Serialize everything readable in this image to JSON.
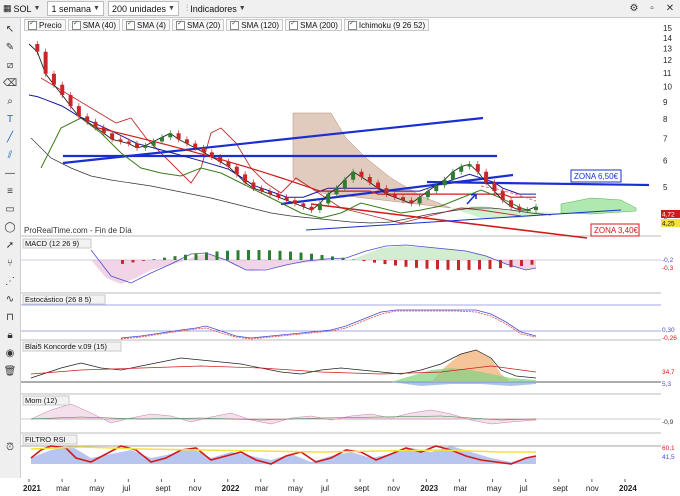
{
  "toolbar": {
    "symbol": "SOL",
    "timeframe": "1 semana",
    "units": "200 unidades",
    "indicators": "Indicadores"
  },
  "legend": {
    "price": "Precio",
    "sma40": "SMA (40)",
    "sma4": "SMA (4)",
    "sma20": "SMA (20)",
    "sma120": "SMA (120)",
    "sma200": "SMA (200)",
    "ichimoku": "Ichimoku (9 26 52)"
  },
  "colors": {
    "sma40": "#1a1a9a",
    "sma4": "#111111",
    "sma20": "#3a7d1e",
    "sma120": "#d11a1a",
    "sma200": "#e06a6a",
    "ichimoku": "#b8312f",
    "up_candle": "#2e7d32",
    "down_candle": "#c62828",
    "cloud_green": "#8ee08e",
    "cloud_red": "#c8a08a",
    "trend_blue": "#1a2fd0",
    "trend_red": "#d11a1a"
  },
  "watermark": "ProRealTime.com - Fin de Día",
  "annotations": {
    "zone_high": "ZONA 6,50€",
    "zone_low": "ZONA 3,40€"
  },
  "panels": {
    "macd": "MACD (12 26 9)",
    "stochastic": "Estocástico (26 8 5)",
    "koncorde": "Blai5 Koncorde v.09 (15)",
    "momentum": "Mom (12)",
    "rsi": "FILTRO RSI"
  },
  "chart_data": {
    "type": "line",
    "price_axis_ticks": [
      "15",
      "14",
      "13",
      "12",
      "11",
      "10",
      "9",
      "8",
      "7",
      "6",
      "5",
      "4"
    ],
    "price_labels_right": [
      "4,72",
      "4,25"
    ],
    "macd_labels_right": [
      "-0,2",
      "-0,3"
    ],
    "stoch_labels_right": [
      "0,30",
      "-0,26"
    ],
    "koncorde_labels_right": [
      "34,7",
      "5,3"
    ],
    "mom_labels_right": [
      "-0,9"
    ],
    "rsi_labels_right": [
      "60,1",
      "41,5"
    ],
    "time_ticks": [
      "2021",
      "mar",
      "may",
      "jul",
      "sept",
      "nov",
      "2022",
      "mar",
      "may",
      "jul",
      "sept",
      "nov",
      "2023",
      "mar",
      "may",
      "jul",
      "sept",
      "nov",
      "2024"
    ],
    "price_series": [
      13.5,
      12.8,
      11.0,
      10.2,
      9.5,
      8.8,
      8.2,
      7.9,
      7.6,
      7.3,
      7.0,
      6.9,
      6.8,
      6.6,
      6.7,
      6.9,
      7.1,
      7.3,
      7.0,
      6.8,
      6.6,
      6.4,
      6.2,
      6.0,
      5.8,
      5.5,
      5.2,
      5.0,
      4.9,
      4.8,
      4.7,
      4.6,
      4.5,
      4.4,
      4.3,
      4.5,
      4.8,
      5.0,
      5.3,
      5.6,
      5.4,
      5.2,
      5.0,
      4.8,
      4.7,
      4.6,
      4.5,
      4.7,
      4.9,
      5.1,
      5.3,
      5.6,
      5.8,
      5.9,
      5.6,
      5.2,
      4.9,
      4.6,
      4.4,
      4.3,
      4.3,
      4.4
    ],
    "sma40_series": [
      9.5,
      9.4,
      9.2,
      9.0,
      8.8,
      8.5,
      8.2,
      8.0,
      7.8,
      7.6,
      7.4,
      7.2,
      7.0,
      6.8,
      6.7,
      6.6,
      6.5,
      6.4,
      6.3,
      6.2,
      6.1,
      6.0,
      5.9,
      5.8,
      5.7,
      5.5,
      5.3,
      5.1,
      5.0,
      4.9,
      4.8,
      4.7,
      4.7,
      4.7,
      4.8,
      4.9,
      5.0,
      5.0,
      5.0,
      5.0,
      5.0,
      5.0,
      5.0,
      4.9,
      4.9,
      4.9,
      4.9,
      4.9,
      5.0,
      5.1,
      5.2,
      5.3,
      5.4,
      5.5,
      5.4,
      5.3,
      5.2,
      5.0,
      4.9,
      4.8,
      4.8,
      4.8
    ],
    "sma120_series": [
      null,
      null,
      null,
      null,
      null,
      null,
      null,
      null,
      7.6,
      7.5,
      7.4,
      7.3,
      7.2,
      7.1,
      7.0,
      6.9,
      6.8,
      6.7,
      6.6,
      6.5,
      6.4,
      6.3,
      6.2,
      6.1,
      6.0,
      5.9,
      5.8,
      5.7,
      5.6,
      5.5,
      5.4,
      5.3,
      5.2,
      5.1,
      5.0,
      4.9,
      4.9,
      4.9,
      4.9,
      4.9,
      4.9,
      4.9,
      4.8,
      4.8,
      4.8,
      4.8,
      4.8,
      4.8,
      4.8,
      4.8,
      4.8,
      4.8,
      4.8,
      4.8,
      4.8,
      4.8,
      4.8,
      4.8,
      4.7,
      4.7,
      4.7,
      4.7
    ]
  }
}
